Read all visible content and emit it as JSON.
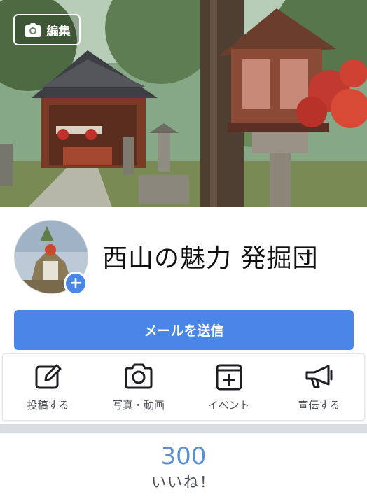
{
  "cover": {
    "edit_label": "編集"
  },
  "profile": {
    "page_name": "西山の魅力 発掘団",
    "add_photo_symbol": "+"
  },
  "send_message": {
    "label": "メールを送信"
  },
  "actions": [
    {
      "label": "投稿する",
      "icon": "compose-icon"
    },
    {
      "label": "写真・動画",
      "icon": "camera-icon"
    },
    {
      "label": "イベント",
      "icon": "event-calendar-icon"
    },
    {
      "label": "宣伝する",
      "icon": "megaphone-icon"
    }
  ],
  "likes": {
    "count": "300",
    "label": "いいね！"
  },
  "colors": {
    "accent": "#4a86e8",
    "likes_count": "#5b8fd1"
  }
}
